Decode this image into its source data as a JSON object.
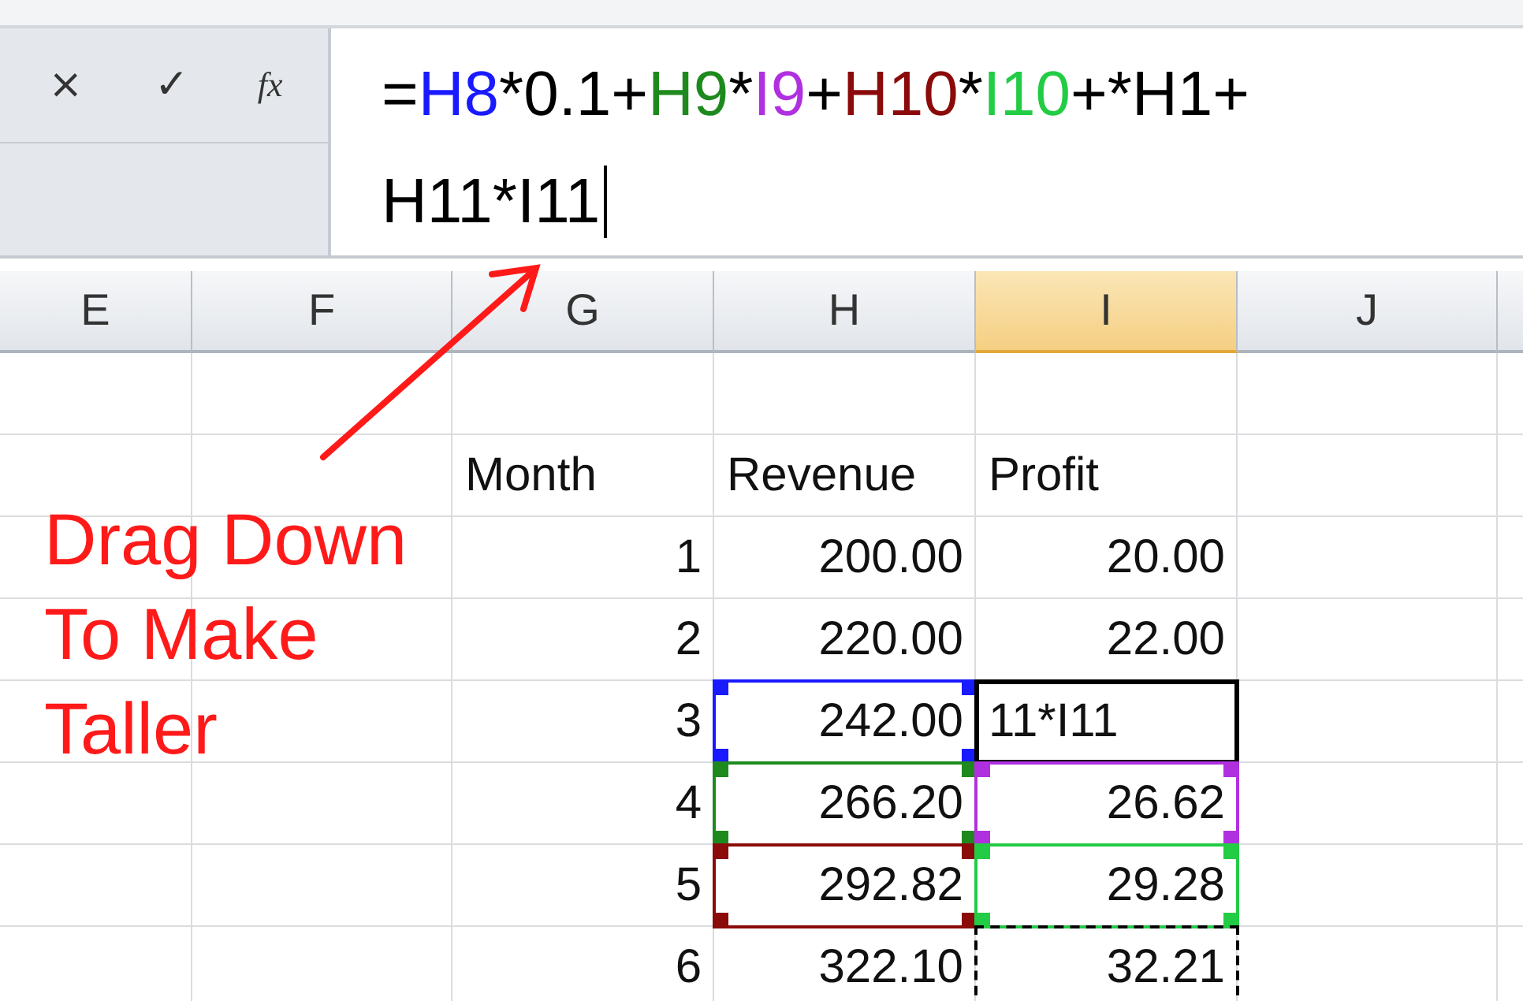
{
  "formula_bar": {
    "buttons": [
      "×",
      "✓"
    ],
    "function_label": "fx",
    "lines": [
      [
        {
          "text": "=",
          "color": "#000000"
        },
        {
          "text": "H8",
          "color": "#1a1aff"
        },
        {
          "text": "*0.1+",
          "color": "#000000"
        },
        {
          "text": "H9",
          "color": "#1e8a1e"
        },
        {
          "text": "*",
          "color": "#000000"
        },
        {
          "text": "I9",
          "color": "#b030e0"
        },
        {
          "text": "+",
          "color": "#000000"
        },
        {
          "text": "H10",
          "color": "#8b0a0a"
        },
        {
          "text": "*",
          "color": "#000000"
        },
        {
          "text": "I10",
          "color": "#22cc44"
        },
        {
          "text": "+*H1+",
          "color": "#000000"
        }
      ],
      [
        {
          "text": "H11*I11",
          "color": "#000000"
        }
      ]
    ]
  },
  "columns": [
    {
      "label": "E",
      "selected": false
    },
    {
      "label": "F",
      "selected": false
    },
    {
      "label": "G",
      "selected": false
    },
    {
      "label": "H",
      "selected": false
    },
    {
      "label": "I",
      "selected": true
    },
    {
      "label": "J",
      "selected": false
    }
  ],
  "rows": [
    [
      null,
      null,
      null,
      null,
      null,
      null
    ],
    [
      null,
      null,
      {
        "text": "Month",
        "kind": "text"
      },
      {
        "text": "Revenue",
        "kind": "text"
      },
      {
        "text": "Profit",
        "kind": "text"
      },
      null
    ],
    [
      null,
      null,
      {
        "text": "1",
        "kind": "number"
      },
      {
        "text": "200.00",
        "kind": "number"
      },
      {
        "text": "20.00",
        "kind": "number"
      },
      null
    ],
    [
      null,
      null,
      {
        "text": "2",
        "kind": "number"
      },
      {
        "text": "220.00",
        "kind": "number"
      },
      {
        "text": "22.00",
        "kind": "number"
      },
      null
    ],
    [
      null,
      null,
      {
        "text": "3",
        "kind": "number"
      },
      {
        "text": "242.00",
        "kind": "number",
        "color": "#1a1aff"
      },
      {
        "text": "11*I11",
        "kind": "editing"
      },
      null
    ],
    [
      null,
      null,
      {
        "text": "4",
        "kind": "number"
      },
      {
        "text": "266.20",
        "kind": "number",
        "color": "#1e8a1e"
      },
      {
        "text": "26.62",
        "kind": "number",
        "color": "#b030e0"
      },
      null
    ],
    [
      null,
      null,
      {
        "text": "5",
        "kind": "number"
      },
      {
        "text": "292.82",
        "kind": "number",
        "color": "#8b0a0a"
      },
      {
        "text": "29.28",
        "kind": "number",
        "color": "#22cc44"
      },
      null
    ],
    [
      null,
      null,
      {
        "text": "6",
        "kind": "number"
      },
      {
        "text": "322.10",
        "kind": "number"
      },
      {
        "text": "32.21",
        "kind": "marquee"
      },
      null
    ]
  ],
  "annotation": {
    "text": "Drag Down To Make Taller"
  }
}
